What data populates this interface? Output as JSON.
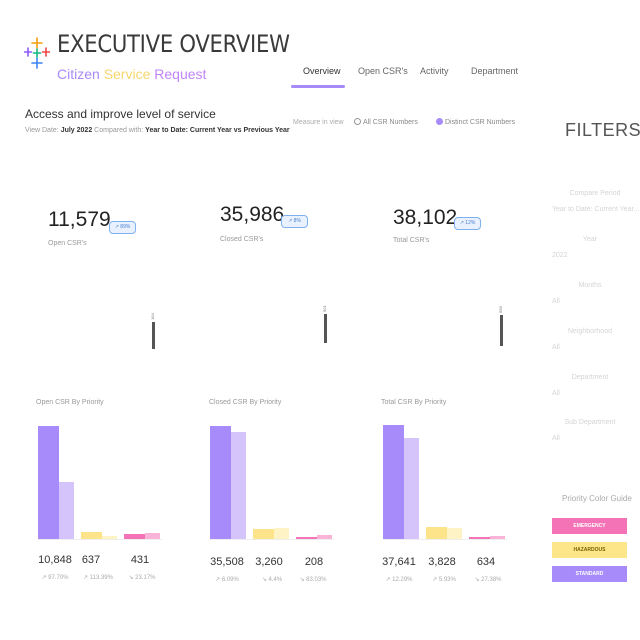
{
  "header": {
    "title": "EXECUTIVE OVERVIEW",
    "subtitle_parts": [
      "Citizen",
      "Service",
      "Request"
    ],
    "logo_icon": "tableau-logo-icon"
  },
  "tabs": [
    {
      "label": "Overview",
      "active": true
    },
    {
      "label": "Open CSR's",
      "active": false
    },
    {
      "label": "Activity",
      "active": false
    },
    {
      "label": "Department",
      "active": false
    }
  ],
  "intro": {
    "title": "Access and improve level of service",
    "view_prefix": "View Date:",
    "view_date": "July 2022",
    "compared_prefix": "Compared with:",
    "compared_value": "Year to Date: Current Year vs Previous Year"
  },
  "measure": {
    "label": "Measure in view",
    "options": [
      {
        "label": "All CSR Numbers",
        "selected": false
      },
      {
        "label": "Distinct CSR Numbers",
        "selected": true
      }
    ]
  },
  "kpis": [
    {
      "value": "11,579",
      "label": "Open CSR's",
      "badge": "↗ 89%",
      "spark_value": "164"
    },
    {
      "value": "35,986",
      "label": "Closed CSR's",
      "badge": "↗ 8%",
      "spark_value": "901"
    },
    {
      "value": "38,102",
      "label": "Total CSR's",
      "badge": "↗ 12%",
      "spark_value": "658"
    }
  ],
  "charts": [
    {
      "title": "Open CSR By Priority",
      "values": [
        "10,848",
        "637",
        "431"
      ],
      "changes": [
        "↗ 97.70%",
        "↗ 113.39%",
        "↘ 23.17%"
      ]
    },
    {
      "title": "Closed CSR By Priority",
      "values": [
        "35,508",
        "3,260",
        "208"
      ],
      "changes": [
        "↗ 6.09%",
        "↘ 4.4%",
        "↘ 83.03%"
      ]
    },
    {
      "title": "Total CSR By Priority",
      "values": [
        "37,641",
        "3,828",
        "634"
      ],
      "changes": [
        "↗ 12.29%",
        "↗ 5.93%",
        "↘ 27.38%"
      ]
    }
  ],
  "chart_data": [
    {
      "type": "bar",
      "title": "Open CSR By Priority",
      "categories": [
        "STANDARD",
        "HAZARDOUS",
        "EMERGENCY"
      ],
      "series": [
        {
          "name": "Current Year",
          "values": [
            10848,
            637,
            431
          ]
        },
        {
          "name": "Previous Year",
          "values": [
            5489,
            298,
            561
          ]
        }
      ],
      "ylim": [
        0,
        11000
      ]
    },
    {
      "type": "bar",
      "title": "Closed CSR By Priority",
      "categories": [
        "STANDARD",
        "HAZARDOUS",
        "EMERGENCY"
      ],
      "series": [
        {
          "name": "Current Year",
          "values": [
            35508,
            3260,
            208
          ]
        },
        {
          "name": "Previous Year",
          "values": [
            33470,
            3410,
            1226
          ]
        }
      ],
      "ylim": [
        0,
        36000
      ]
    },
    {
      "type": "bar",
      "title": "Total CSR By Priority",
      "categories": [
        "STANDARD",
        "HAZARDOUS",
        "EMERGENCY"
      ],
      "series": [
        {
          "name": "Current Year",
          "values": [
            37641,
            3828,
            634
          ]
        },
        {
          "name": "Previous Year",
          "values": [
            33521,
            3614,
            873
          ]
        }
      ],
      "ylim": [
        0,
        38000
      ]
    }
  ],
  "filters": {
    "title": "FILTERS",
    "items": [
      {
        "label": "Compare Period",
        "value": "Year to Date: Current Year..."
      },
      {
        "label": "Year",
        "value": "2022"
      },
      {
        "label": "Months",
        "value": "All"
      },
      {
        "label": "Neighborhood",
        "value": "All"
      },
      {
        "label": "Department",
        "value": "All"
      },
      {
        "label": "Sub Department",
        "value": "All"
      }
    ],
    "guide_title": "Priority Color Guide",
    "guide": [
      {
        "label": "EMERGENCY",
        "color": "#f472b6"
      },
      {
        "label": "HAZARDOUS",
        "color": "#fde68a"
      },
      {
        "label": "STANDARD",
        "color": "#a78bfa"
      }
    ]
  },
  "colors": {
    "accent": "#a78bfa",
    "standard": "#a78bfa",
    "hazardous": "#fde48a",
    "emergency": "#f472b6",
    "badge": "#4b7fd1"
  }
}
